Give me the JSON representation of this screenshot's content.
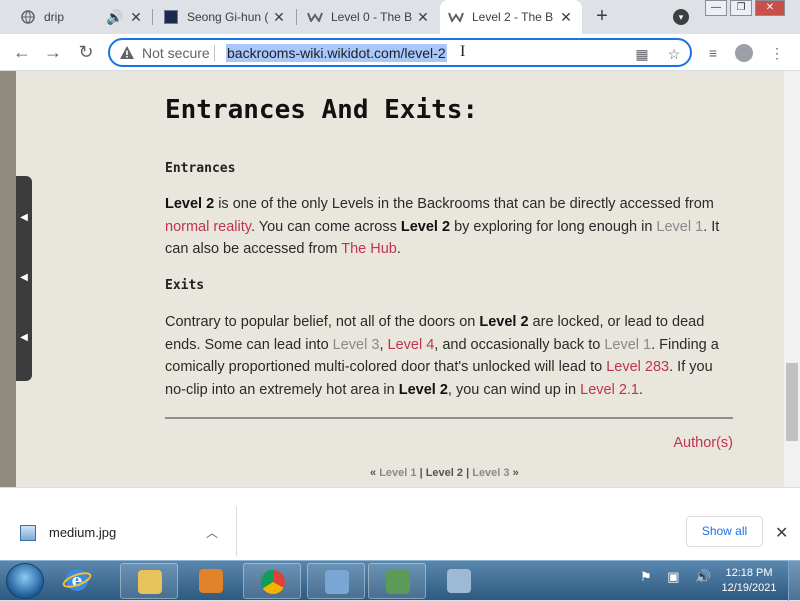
{
  "browser": {
    "tabs": [
      {
        "title": "drip",
        "has_audio": true
      },
      {
        "title": "Seong Gi-hun ("
      },
      {
        "title": "Level 0 - The B"
      },
      {
        "title": "Level 2 - The B",
        "active": true
      }
    ],
    "window_buttons": [
      "—",
      "❐",
      "✕"
    ],
    "address": {
      "security_label": "Not secure",
      "url": "backrooms-wiki.wikidot.com/level-2"
    }
  },
  "page": {
    "heading": "Entrances And Exits:",
    "entrances": {
      "subheading": "Entrances",
      "p1": "Level 2",
      "p2": " is one of the only Levels in the Backrooms that can be directly accessed from ",
      "p3": "normal reality",
      "p4": ". You can come across ",
      "p5": "Level 2",
      "p6": " by exploring for long enough in ",
      "p7": "Level 1",
      "p8": ". It can also be accessed from ",
      "p9": "The Hub",
      "p10": "."
    },
    "exits": {
      "subheading": "Exits",
      "p1": "Contrary to popular belief, not all of the doors on ",
      "p2": "Level 2",
      "p3": " are locked, or lead to dead ends. Some can lead into ",
      "p4": "Level 3",
      "p5": ", ",
      "p6": "Level 4",
      "p7": ", and occasionally back to ",
      "p8": "Level 1",
      "p9": ". Finding a comically proportioned multi-colored door that's unlocked will lead to ",
      "p10": "Level 283",
      "p11": ". If you no-clip into an extremely hot area in ",
      "p12": "Level 2",
      "p13": ", you can wind up in ",
      "p14": "Level 2.1",
      "p15": "."
    },
    "author_link": "Author(s)",
    "pager": {
      "prev_mark": "«",
      "prev": "Level 1",
      "sep1": "|",
      "current": "Level 2",
      "sep2": "|",
      "next": "Level 3",
      "next_mark": "»"
    }
  },
  "downloads": {
    "file_name": "medium.jpg",
    "show_all": "Show all"
  },
  "taskbar": {
    "time": "12:18 PM",
    "date": "12/19/2021"
  },
  "colors": {
    "link_red": "#c0354d",
    "link_gray": "#8a8a8a",
    "page_bg": "#e8e6dd",
    "accent": "#1a73e8"
  }
}
